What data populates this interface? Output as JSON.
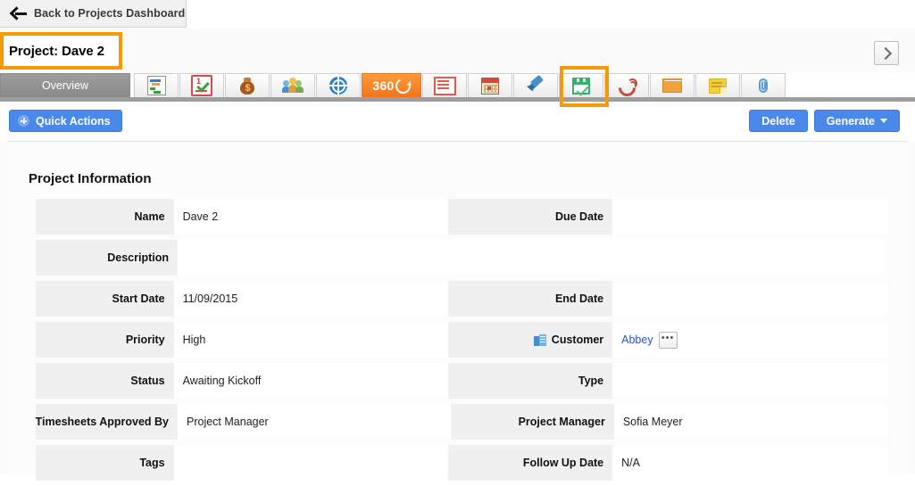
{
  "back_bar": {
    "label": "Back to Projects Dashboard",
    "icon": "back-arrow-icon"
  },
  "header": {
    "title": "Project: Dave 2",
    "next_icon": "chevron-right-icon"
  },
  "tabs": [
    {
      "label": "Overview",
      "icon": "",
      "type": "text",
      "state": "active"
    },
    {
      "label": "",
      "icon": "gantt-chart-icon",
      "type": "icon",
      "state": "normal"
    },
    {
      "label": "",
      "icon": "task-approval-icon",
      "type": "icon",
      "state": "normal"
    },
    {
      "label": "",
      "icon": "money-bag-icon",
      "type": "icon",
      "state": "normal"
    },
    {
      "label": "",
      "icon": "users-group-icon",
      "type": "icon",
      "state": "normal"
    },
    {
      "label": "",
      "icon": "globe-icon",
      "type": "icon",
      "state": "normal"
    },
    {
      "label": "360",
      "icon": "circular-arrow-icon",
      "type": "threesixty",
      "state": "orange"
    },
    {
      "label": "",
      "icon": "news-list-icon",
      "type": "icon",
      "state": "normal"
    },
    {
      "label": "",
      "icon": "calendar-icon",
      "type": "icon",
      "state": "normal"
    },
    {
      "label": "",
      "icon": "pin-icon",
      "type": "icon",
      "state": "normal"
    },
    {
      "label": "",
      "icon": "calendar-check-icon",
      "type": "icon",
      "state": "highlighted"
    },
    {
      "label": "",
      "icon": "phone-call-icon",
      "type": "icon",
      "state": "normal"
    },
    {
      "label": "",
      "icon": "email-icon",
      "type": "icon",
      "state": "normal"
    },
    {
      "label": "",
      "icon": "note-icon",
      "type": "icon",
      "state": "normal"
    },
    {
      "label": "",
      "icon": "paperclip-icon",
      "type": "icon",
      "state": "normal"
    }
  ],
  "toolbar": {
    "quick_actions_label": "Quick Actions",
    "quick_actions_icon": "plus-circle-icon",
    "delete_label": "Delete",
    "generate_label": "Generate"
  },
  "main": {
    "section_title": "Project Information",
    "fields": {
      "name": {
        "label": "Name",
        "value": "Dave 2"
      },
      "due_date": {
        "label": "Due Date",
        "value": ""
      },
      "description": {
        "label": "Description",
        "value": ""
      },
      "start_date": {
        "label": "Start Date",
        "value": "11/09/2015"
      },
      "end_date": {
        "label": "End Date",
        "value": ""
      },
      "priority": {
        "label": "Priority",
        "value": "High"
      },
      "customer": {
        "label": "Customer",
        "value": "Abbey",
        "icon": "building-icon",
        "more_label": "•••"
      },
      "status": {
        "label": "Status",
        "value": "Awaiting Kickoff"
      },
      "type": {
        "label": "Type",
        "value": ""
      },
      "timesheets_approved_by": {
        "label": "Timesheets Approved By",
        "value": "Project Manager"
      },
      "project_manager": {
        "label": "Project Manager",
        "value": "Sofia Meyer"
      },
      "tags": {
        "label": "Tags",
        "value": ""
      },
      "follow_up_date": {
        "label": "Follow Up Date",
        "value": "N/A"
      }
    }
  },
  "colors": {
    "highlight": "#f59a00",
    "accent_blue": "#4a89ea",
    "tab_orange": "#f4741a",
    "link_blue": "#2b50d8",
    "active_tab_gray": "#8a8a8a"
  }
}
